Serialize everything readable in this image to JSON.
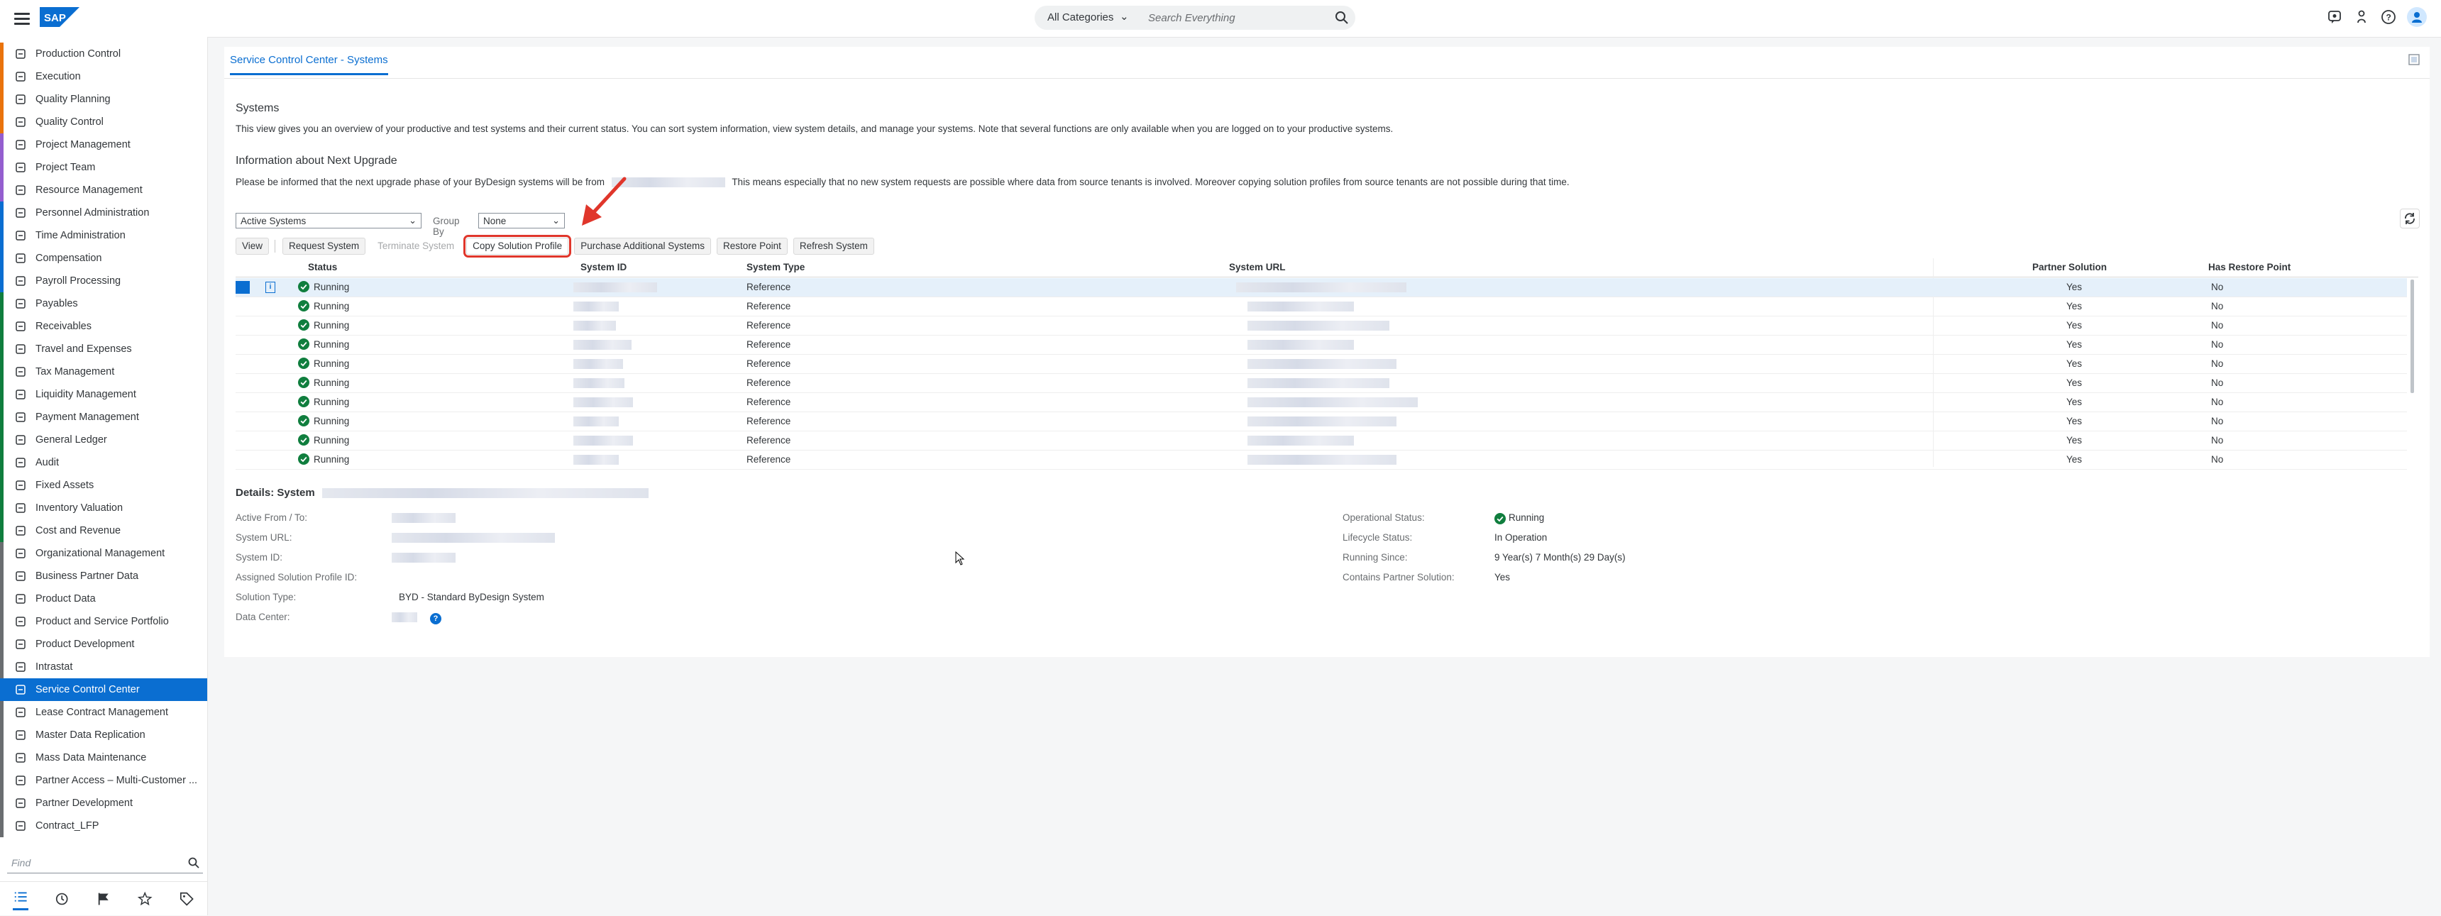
{
  "shell": {
    "category": "All Categories",
    "search_placeholder": "Search Everything",
    "logo_text": "SAP"
  },
  "sidebar": {
    "items": [
      {
        "label": "Production Control",
        "color": "#e9730c",
        "icon": "production-icon"
      },
      {
        "label": "Execution",
        "color": "#e9730c",
        "icon": "execution-icon"
      },
      {
        "label": "Quality Planning",
        "color": "#e9730c",
        "icon": "quality-planning-icon"
      },
      {
        "label": "Quality Control",
        "color": "#e9730c",
        "icon": "quality-control-icon"
      },
      {
        "label": "Project Management",
        "color": "#945ecf",
        "icon": "project-icon"
      },
      {
        "label": "Project Team",
        "color": "#945ecf",
        "icon": "team-icon"
      },
      {
        "label": "Resource Management",
        "color": "#945ecf",
        "icon": "resource-icon"
      },
      {
        "label": "Personnel Administration",
        "color": "#0a6ed1",
        "icon": "person-icon"
      },
      {
        "label": "Time Administration",
        "color": "#0a6ed1",
        "icon": "time-icon"
      },
      {
        "label": "Compensation",
        "color": "#0a6ed1",
        "icon": "compensation-icon"
      },
      {
        "label": "Payroll Processing",
        "color": "#0a6ed1",
        "icon": "payroll-icon"
      },
      {
        "label": "Payables",
        "color": "#107e3e",
        "icon": "payables-icon"
      },
      {
        "label": "Receivables",
        "color": "#107e3e",
        "icon": "receivables-icon"
      },
      {
        "label": "Travel and Expenses",
        "color": "#107e3e",
        "icon": "travel-icon"
      },
      {
        "label": "Tax Management",
        "color": "#107e3e",
        "icon": "tax-icon"
      },
      {
        "label": "Liquidity Management",
        "color": "#107e3e",
        "icon": "liquidity-icon"
      },
      {
        "label": "Payment Management",
        "color": "#107e3e",
        "icon": "payment-icon"
      },
      {
        "label": "General Ledger",
        "color": "#107e3e",
        "icon": "ledger-icon"
      },
      {
        "label": "Audit",
        "color": "#107e3e",
        "icon": "audit-icon"
      },
      {
        "label": "Fixed Assets",
        "color": "#107e3e",
        "icon": "assets-icon"
      },
      {
        "label": "Inventory Valuation",
        "color": "#107e3e",
        "icon": "inventory-icon"
      },
      {
        "label": "Cost and Revenue",
        "color": "#107e3e",
        "icon": "cost-icon"
      },
      {
        "label": "Organizational Management",
        "color": "#6a6d70",
        "icon": "org-icon"
      },
      {
        "label": "Business Partner Data",
        "color": "#6a6d70",
        "icon": "partner-data-icon"
      },
      {
        "label": "Product Data",
        "color": "#6a6d70",
        "icon": "product-data-icon"
      },
      {
        "label": "Product and Service Portfolio",
        "color": "#6a6d70",
        "icon": "portfolio-icon"
      },
      {
        "label": "Product Development",
        "color": "#6a6d70",
        "icon": "development-icon"
      },
      {
        "label": "Intrastat",
        "color": "#6a6d70",
        "icon": "intrastat-icon"
      },
      {
        "label": "Service Control Center",
        "color": "#0a6ed1",
        "icon": "service-control-icon",
        "active": true
      },
      {
        "label": "Lease Contract Management",
        "color": "#6a6d70",
        "icon": "lease-icon"
      },
      {
        "label": "Master Data Replication",
        "color": "#6a6d70",
        "icon": "replication-icon"
      },
      {
        "label": "Mass Data Maintenance",
        "color": "#6a6d70",
        "icon": "mass-data-icon"
      },
      {
        "label": "Partner Access – Multi-Customer ...",
        "color": "#6a6d70",
        "icon": "partner-access-icon"
      },
      {
        "label": "Partner Development",
        "color": "#6a6d70",
        "icon": "partner-dev-icon"
      },
      {
        "label": "Contract_LFP",
        "color": "#6a6d70",
        "icon": "contract-icon"
      }
    ],
    "find_placeholder": "Find"
  },
  "main": {
    "tab_title": "Service Control Center - Systems",
    "systems_title": "Systems",
    "systems_text": "This view gives you an overview of your productive and test systems and their current status. You can sort system information, view system details, and manage your systems. Note that several functions are only available when you are logged on to your productive systems.",
    "upgrade_title": "Information about Next Upgrade",
    "upgrade_text_1": "Please be informed that the next upgrade phase of your ByDesign systems will be from",
    "upgrade_text_2": "This means especially that no new system requests are possible where data from source tenants is involved. Moreover copying solution profiles from source tenants are not possible during that time.",
    "filter": {
      "view_value": "Active Systems",
      "group_by_label": "Group By",
      "group_by_value": "None"
    },
    "toolbar": {
      "view": "View",
      "request_system": "Request System",
      "terminate_system": "Terminate System",
      "copy_solution_profile": "Copy Solution Profile",
      "purchase_additional": "Purchase Additional Systems",
      "restore_point": "Restore Point",
      "refresh_system": "Refresh System"
    },
    "table": {
      "headers": {
        "status": "Status",
        "system_id": "System ID",
        "system_type": "System Type",
        "system_url": "System URL",
        "partner_solution": "Partner Solution",
        "has_restore_point": "Has Restore Point"
      },
      "rows": [
        {
          "status": "Running",
          "type": "Reference",
          "partner": "Yes",
          "restore": "No"
        },
        {
          "status": "Running",
          "type": "Reference",
          "partner": "Yes",
          "restore": "No"
        },
        {
          "status": "Running",
          "type": "Reference",
          "partner": "Yes",
          "restore": "No"
        },
        {
          "status": "Running",
          "type": "Reference",
          "partner": "Yes",
          "restore": "No"
        },
        {
          "status": "Running",
          "type": "Reference",
          "partner": "Yes",
          "restore": "No"
        },
        {
          "status": "Running",
          "type": "Reference",
          "partner": "Yes",
          "restore": "No"
        },
        {
          "status": "Running",
          "type": "Reference",
          "partner": "Yes",
          "restore": "No"
        },
        {
          "status": "Running",
          "type": "Reference",
          "partner": "Yes",
          "restore": "No"
        },
        {
          "status": "Running",
          "type": "Reference",
          "partner": "Yes",
          "restore": "No"
        },
        {
          "status": "Running",
          "type": "Reference",
          "partner": "Yes",
          "restore": "No"
        }
      ]
    },
    "details": {
      "title": "Details: System",
      "active_from_label": "Active From / To:",
      "system_url_label": "System URL:",
      "system_id_label": "System ID:",
      "assigned_profile_label": "Assigned Solution Profile ID:",
      "solution_type_label": "Solution Type:",
      "solution_type_value": "BYD - Standard ByDesign System",
      "data_center_label": "Data Center:",
      "operational_status_label": "Operational Status:",
      "operational_status_value": "Running",
      "lifecycle_status_label": "Lifecycle Status:",
      "lifecycle_status_value": "In Operation",
      "running_since_label": "Running Since:",
      "running_since_value": "9 Year(s) 7 Month(s) 29 Day(s)",
      "contains_partner_label": "Contains Partner Solution:",
      "contains_partner_value": "Yes"
    }
  },
  "colors": {
    "accent": "#0a6ed1",
    "highlight": "#e0362b",
    "success": "#107e3e"
  }
}
